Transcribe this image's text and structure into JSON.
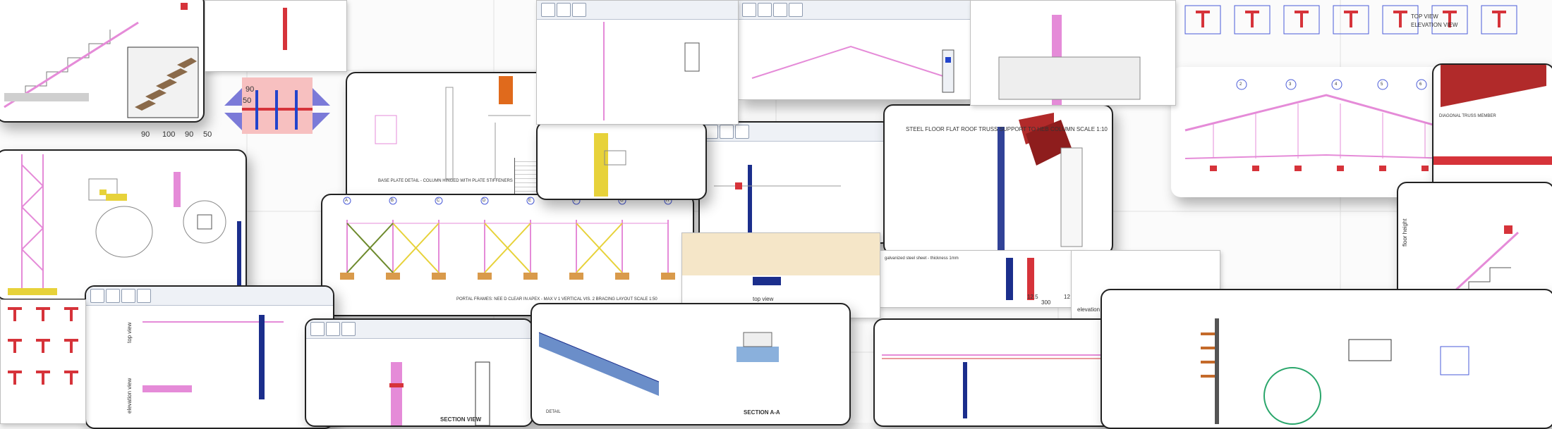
{
  "colors": {
    "steel_pink": "#e58bd8",
    "steel_red": "#d6333a",
    "steel_blue": "#2244cc",
    "concrete_grey": "#b7b7b7",
    "brace_yellow": "#e7d23a",
    "accent_green": "#2c8b3c"
  },
  "icons": [
    "ribbon-toolbar-icon",
    "titleblock-logo-icon"
  ],
  "labels": {
    "top_view_left": "top view",
    "elevation_view_left": "elevation view",
    "elevation_view_right": "elevation view",
    "top_view_mid": "top view",
    "section_view": "SECTION VIEW",
    "section_aa": "SECTION A-A",
    "detail": "DETAIL",
    "floor_height": "floor height",
    "portal_frame_note": "PORTAL FRAMES: NEE D CLEAR IN APEX - MAX V 1 VERTICAL VIS. 2 BRACING LAYOUT SCALE 1:50",
    "column_base_note": "BASE PLATE DETAIL - COLUMN HINGED WITH PLATE STIFFENERS SCALE 1:10",
    "truss_support_note": "STEEL FLOOR FLAT ROOF TRUSS SUPPORT TO HEB COLUMN SCALE 1:10",
    "dim_90_a": "90",
    "dim_50": "50",
    "dim_90_b": "90",
    "dim_100": "100",
    "dim_90_c": "90",
    "dim_50_b": "50",
    "dim_12_5": "12.5",
    "dim_300": "300",
    "dim_12": "12",
    "grid_2": "2",
    "grid_3": "3",
    "grid_4": "4",
    "grid_5": "5",
    "grid_6": "6",
    "grid_A": "A",
    "grid_B": "B",
    "grid_C": "C",
    "grid_D": "D",
    "grid_E": "E",
    "grid_F": "F",
    "grid_G": "G",
    "grid_H": "H",
    "diagonal_truss_note": "DIAGONAL TRUSS MEMBER",
    "galvanized_note": "galvanized steel sheet - thickness 1mm",
    "flat_top": "TOP VIEW",
    "elevation_caps": "ELEVATION VIEW"
  }
}
